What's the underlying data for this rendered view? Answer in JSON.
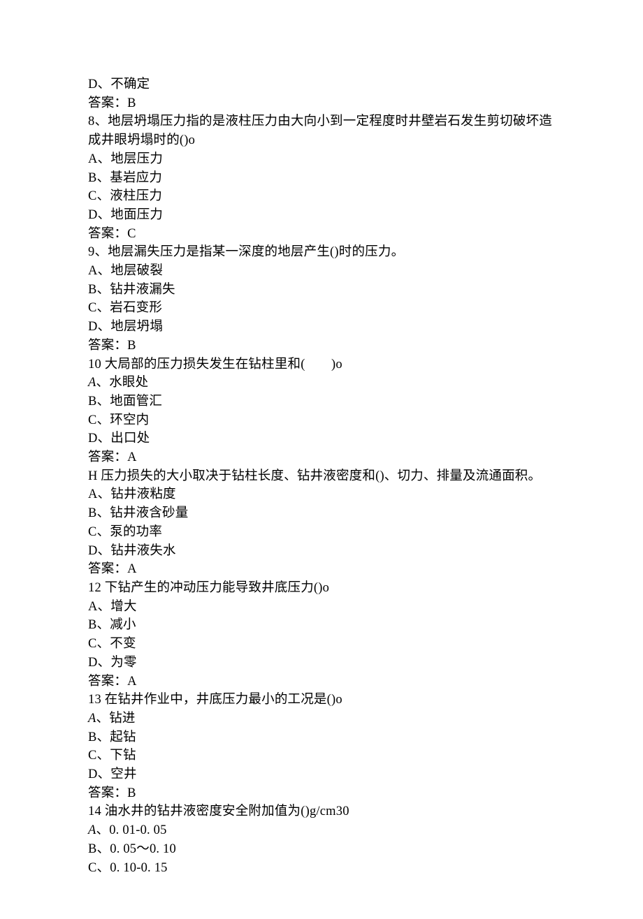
{
  "top_fragment": {
    "option_d": "D、不确定",
    "answer": "答案：B"
  },
  "q8": {
    "stem": "8、地层坍塌压力指的是液柱压力由大向小到一定程度时井壁岩石发生剪切破坏造成井眼坍塌时的()o",
    "a": "A、地层压力",
    "b": "B、基岩应力",
    "c": "C、液柱压力",
    "d": "D、地面压力",
    "answer": "答案：C"
  },
  "q9": {
    "stem": "9、地层漏失压力是指某一深度的地层产生()时的压力。",
    "a": "A、地层破裂",
    "b": "B、钻井液漏失",
    "c": "C、岩石变形",
    "d": "D、地层坍塌",
    "answer": "答案：B"
  },
  "q10": {
    "stem": "10 大局部的压力损失发生在钻柱里和(  )o",
    "a_prefix": "A",
    "a_rest": "、水眼处",
    "b": "B、地面管汇",
    "c": "C、环空内",
    "d": "D、出口处",
    "answer": "答案：A"
  },
  "q11": {
    "stem": "H 压力损失的大小取决于钻柱长度、钻井液密度和()、切力、排量及流通面积。",
    "a": "A、钻井液粘度",
    "b": "B、钻井液含砂量",
    "c": "C、泵的功率",
    "d": "D、钻井液失水",
    "answer": "答案：A"
  },
  "q12": {
    "stem": "12 下钻产生的冲动压力能导致井底压力()o",
    "a": "A、增大",
    "b": "B、减小",
    "c": "C、不变",
    "d": "D、为零",
    "answer": "答案：A"
  },
  "q13": {
    "stem": "13 在钻井作业中，井底压力最小的工况是()o",
    "a_prefix": "A",
    "a_rest": "、钻进",
    "b": "B、起钻",
    "c": "C、下钻",
    "d": "D、空井",
    "answer": "答案：B"
  },
  "q14": {
    "stem": "14 油水井的钻井液密度安全附加值为()g/cm30",
    "a_prefix": "A",
    "a_rest": "、0. 01-0. 05",
    "b": "B、0. 05～0. 10",
    "c": "C、0. 10-0. 15"
  }
}
